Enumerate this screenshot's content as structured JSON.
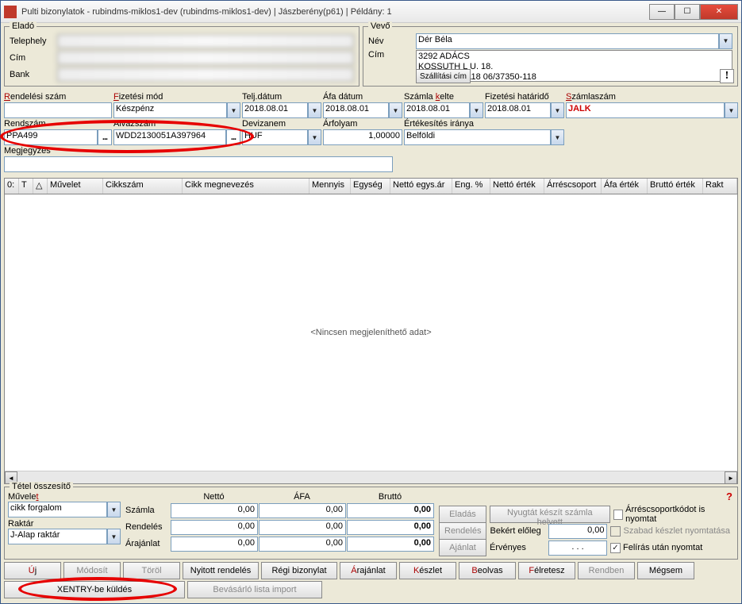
{
  "title": "Pulti bizonylatok - rubindms-miklos1-dev (rubindms-miklos1-dev) | Jászberény(p61) | Példány: 1",
  "seller": {
    "title": "Eladó",
    "site_lbl": "Telephely",
    "addr_lbl": "Cím",
    "bank_lbl": "Bank"
  },
  "buyer": {
    "title": "Vevő",
    "name_lbl": "Név",
    "name": "Dér Béla",
    "addr_lbl": "Cím",
    "addr_line1": "3292 ADÁCS",
    "addr_line2": "KOSSUTH L U. 18.",
    "addr_line3": "T: 0637/350-118 06/37350-118",
    "ship_btn": "Szállítási cím"
  },
  "hdr": {
    "order_no_lbl": "Rendelési szám",
    "pay_lbl": "Fizetési mód",
    "pay": "Készpénz",
    "perf_lbl": "Telj.dátum",
    "perf": "2018.08.01",
    "vat_lbl": "Áfa dátum",
    "vat": "2018.08.01",
    "inv_date_lbl": "Számla kelte",
    "inv_date": "2018.08.01",
    "due_lbl": "Fizetési határidő",
    "due": "2018.08.01",
    "inv_no_lbl": "Számlaszám",
    "inv_no": "JALK",
    "plate_lbl": "Rendszám",
    "plate": "PPA499",
    "vin_lbl": "Alvázszám",
    "vin": "WDD2130051A397964",
    "curr_lbl": "Devizanem",
    "curr": "HUF",
    "rate_lbl": "Árfolyam",
    "rate": "1,00000",
    "dir_lbl": "Értékesítés iránya",
    "dir": "Belföldi",
    "note_lbl": "Megjegyzés"
  },
  "grid": {
    "cols": [
      "0:",
      "T",
      "△",
      "Művelet",
      "Cikkszám",
      "Cikk megnevezés",
      "Mennyis",
      "Egység",
      "Nettó egys.ár",
      "Eng. %",
      "Nettó érték",
      "Árréscsoport",
      "Áfa érték",
      "Bruttó érték",
      "Rakt"
    ],
    "empty": "<Nincsen megjeleníthető adat>"
  },
  "totals": {
    "title": "Tétel összesítő",
    "op_lbl": "Művelet",
    "op": "cikk forgalom",
    "wh_lbl": "Raktár",
    "wh": "J-Alap raktár",
    "net_lbl": "Nettó",
    "vat_lbl": "ÁFA",
    "gross_lbl": "Bruttó",
    "rows": [
      {
        "lbl": "Számla",
        "net": "0,00",
        "vat": "0,00",
        "gross": "0,00"
      },
      {
        "lbl": "Rendelés",
        "net": "0,00",
        "vat": "0,00",
        "gross": "0,00"
      },
      {
        "lbl": "Árajánlat",
        "net": "0,00",
        "vat": "0,00",
        "gross": "0,00"
      }
    ],
    "btn_sale": "Eladás",
    "btn_order": "Rendelés",
    "btn_quote": "Ajánlat",
    "btn_receipt": "Nyugtát készít számla helyett",
    "deposit_lbl": "Bekért előleg",
    "deposit": "0,00",
    "valid_lbl": "Érvényes",
    "valid": ". . .",
    "cb1": "Árréscsoportkódot is nyomtat",
    "cb2": "Szabad készlet nyomtatása",
    "cb3": "Felírás után nyomtat"
  },
  "btns": {
    "new": "j",
    "new_pre": "Ú",
    "modify": "Módosít",
    "delete": "Töröl",
    "open_ord": "Nyitott rendelés",
    "old_doc": "Régi bizonylat",
    "quote": "rajánlat",
    "quote_pre": "Á",
    "stock": "észlet",
    "stock_pre": "K",
    "read": "eolvas",
    "read_pre": "B",
    "put": "élretesz",
    "put_pre": "F",
    "ok": "Rendben",
    "cancel": "Mégsem",
    "xentry": "XENTRY-be küldés",
    "shoplist": "Bevásárló lista import"
  }
}
